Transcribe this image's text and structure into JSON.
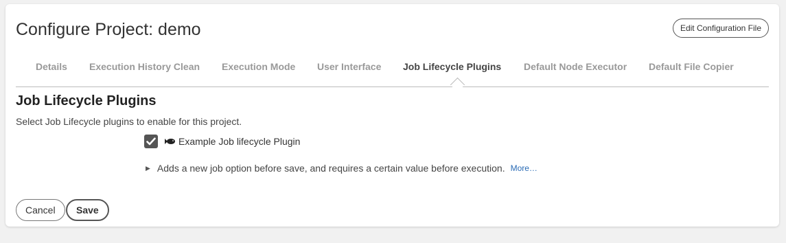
{
  "header": {
    "title": "Configure Project: demo",
    "edit_config_label": "Edit Configuration File"
  },
  "tabs": [
    {
      "label": "Details",
      "active": false
    },
    {
      "label": "Execution History Clean",
      "active": false
    },
    {
      "label": "Execution Mode",
      "active": false
    },
    {
      "label": "User Interface",
      "active": false
    },
    {
      "label": "Job Lifecycle Plugins",
      "active": true
    },
    {
      "label": "Default Node Executor",
      "active": false
    },
    {
      "label": "Default File Copier",
      "active": false
    }
  ],
  "section": {
    "title": "Job Lifecycle Plugins",
    "description": "Select Job Lifecycle plugins to enable for this project."
  },
  "plugin": {
    "checked": true,
    "icon": "fish-icon",
    "name": "Example Job lifecycle Plugin",
    "description": "Adds a new job option before save, and requires a certain value before execution.",
    "more_label": "More…"
  },
  "actions": {
    "cancel_label": "Cancel",
    "save_label": "Save"
  },
  "colors": {
    "background": "#f1f1f1",
    "card": "#ffffff",
    "link": "#2a6bb5",
    "tab_inactive": "#999999",
    "tab_active": "#444444"
  }
}
